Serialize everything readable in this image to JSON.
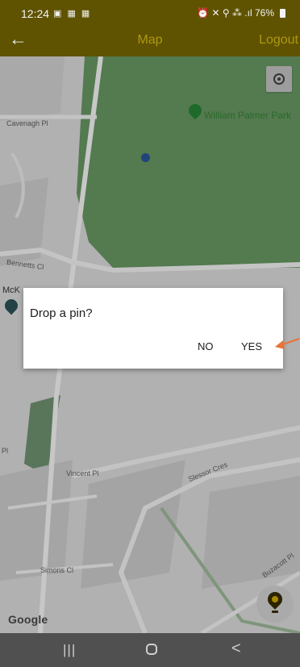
{
  "status_bar": {
    "time": "12:24",
    "left_icons": "▣ ▦ ▦",
    "right_text": "⏰ ✕ ⚲ ⁂ .ıl 76%"
  },
  "app_bar": {
    "back_icon": "←",
    "title": "Map",
    "logout_label": "Logout"
  },
  "map": {
    "park_label": "William Palmer Park",
    "poi_partial_label": "McK",
    "street_labels": {
      "cavenagh": "Cavenagh Pl",
      "bennetts": "Bennetts Cl",
      "vincent": "Vincent Pl",
      "slessor": "Slessor Cres",
      "simons": "Simons Cl",
      "buzacott": "Buzacott Pl",
      "left_edge_pl": "Pl"
    },
    "google_logo": "Google"
  },
  "dialog": {
    "title": "Drop a pin?",
    "no_label": "NO",
    "yes_label": "YES"
  },
  "colors": {
    "app_bar_bg": "#5f5200",
    "title_color": "#ad9810",
    "accent_arrow": "#e8743a"
  },
  "nav_bar": {
    "recents_icon": "|||",
    "back_icon": "<"
  }
}
